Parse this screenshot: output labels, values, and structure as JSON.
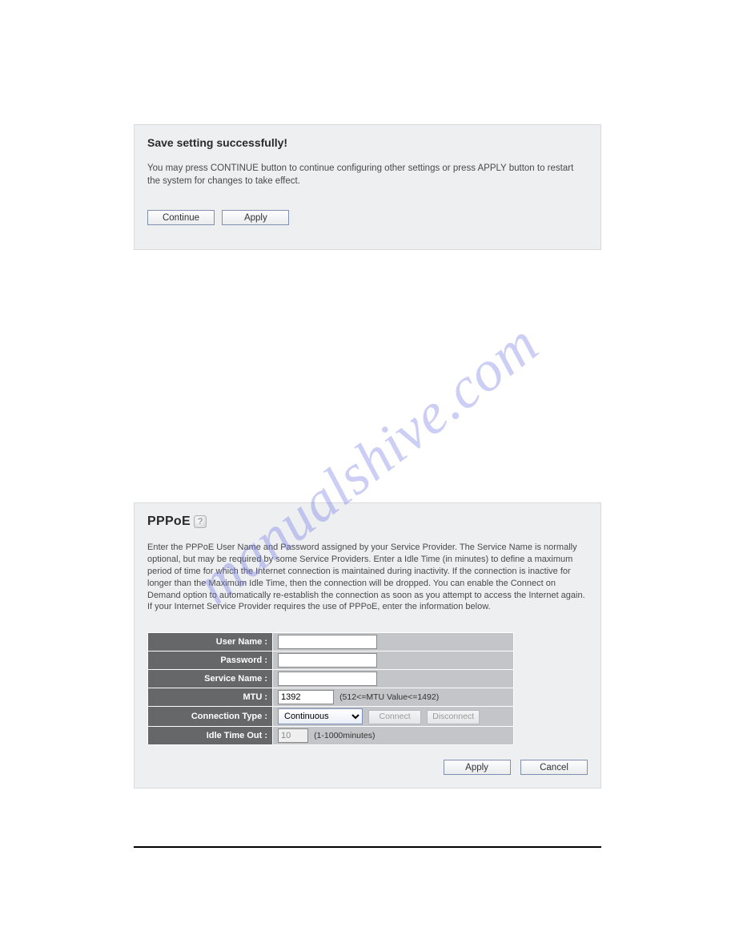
{
  "watermark": "manualshive.com",
  "panel1": {
    "title": "Save setting successfully!",
    "text": "You may press CONTINUE button to continue configuring other settings or press APPLY button to restart the system for changes to take effect.",
    "continue_label": "Continue",
    "apply_label": "Apply"
  },
  "panel2": {
    "title": "PPPoE",
    "help_icon": "?",
    "description": "Enter the PPPoE User Name and Password assigned by your Service Provider. The Service Name is normally optional, but may be required by some Service Providers. Enter a Idle Time (in minutes) to define a maximum period of time for which the Internet connection is maintained during inactivity. If the connection is inactive for longer than the Maximum Idle Time, then the connection will be dropped. You can enable the Connect on Demand option to automatically re-establish the connection as soon as you attempt to access the Internet again.\nIf your Internet Service Provider requires the use of PPPoE, enter the information below.",
    "fields": {
      "user_name_label": "User Name :",
      "user_name_value": "",
      "password_label": "Password :",
      "password_value": "",
      "service_name_label": "Service Name :",
      "service_name_value": "",
      "mtu_label": "MTU :",
      "mtu_value": "1392",
      "mtu_hint": "(512<=MTU Value<=1492)",
      "conn_type_label": "Connection Type :",
      "conn_type_value": "Continuous",
      "connect_label": "Connect",
      "disconnect_label": "Disconnect",
      "idle_label": "Idle Time Out :",
      "idle_value": "10",
      "idle_hint": "(1-1000minutes)"
    },
    "apply_label": "Apply",
    "cancel_label": "Cancel"
  }
}
